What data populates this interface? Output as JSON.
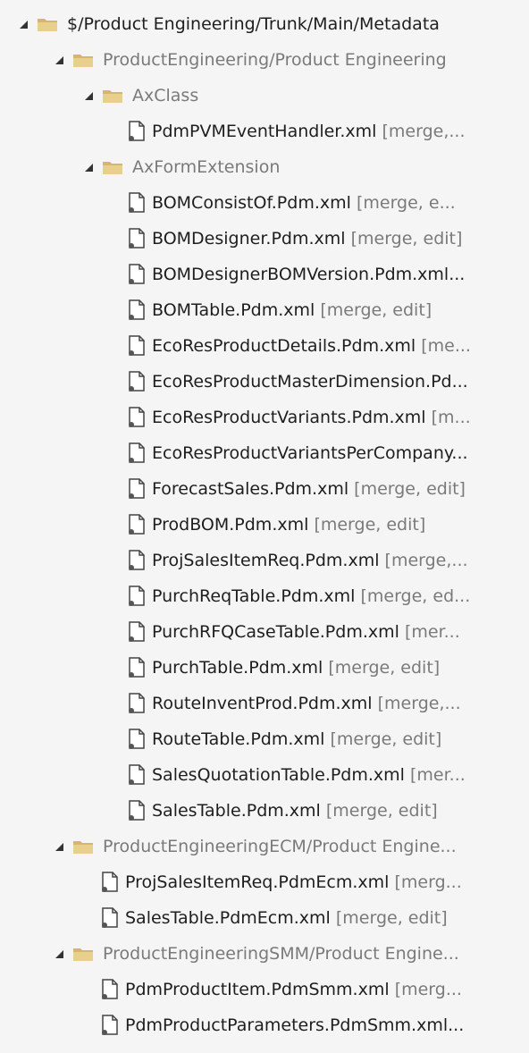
{
  "tree": {
    "root": "$/Product Engineering/Trunk/Main/Metadata",
    "groups": [
      {
        "label": "ProductEngineering/Product Engineering",
        "subfolders": [
          {
            "label": "AxClass",
            "files": [
              {
                "name": "PdmPVMEventHandler.xml",
                "status": "[merge,..."
              }
            ]
          },
          {
            "label": "AxFormExtension",
            "files": [
              {
                "name": "BOMConsistOf.Pdm.xml",
                "status": "[merge, e..."
              },
              {
                "name": "BOMDesigner.Pdm.xml",
                "status": "[merge, edit]"
              },
              {
                "name": "BOMDesignerBOMVersion.Pdm.xml...",
                "status": ""
              },
              {
                "name": "BOMTable.Pdm.xml",
                "status": "[merge, edit]"
              },
              {
                "name": "EcoResProductDetails.Pdm.xml",
                "status": "[me..."
              },
              {
                "name": "EcoResProductMasterDimension.Pd...",
                "status": ""
              },
              {
                "name": "EcoResProductVariants.Pdm.xml",
                "status": "[m..."
              },
              {
                "name": "EcoResProductVariantsPerCompany...",
                "status": ""
              },
              {
                "name": "ForecastSales.Pdm.xml",
                "status": "[merge, edit]"
              },
              {
                "name": "ProdBOM.Pdm.xml",
                "status": "[merge, edit]"
              },
              {
                "name": "ProjSalesItemReq.Pdm.xml",
                "status": "[merge,..."
              },
              {
                "name": "PurchReqTable.Pdm.xml",
                "status": "[merge, ed..."
              },
              {
                "name": "PurchRFQCaseTable.Pdm.xml",
                "status": "[mer..."
              },
              {
                "name": "PurchTable.Pdm.xml",
                "status": "[merge, edit]"
              },
              {
                "name": "RouteInventProd.Pdm.xml",
                "status": "[merge,..."
              },
              {
                "name": "RouteTable.Pdm.xml",
                "status": "[merge, edit]"
              },
              {
                "name": "SalesQuotationTable.Pdm.xml",
                "status": "[mer..."
              },
              {
                "name": "SalesTable.Pdm.xml",
                "status": "[merge, edit]"
              }
            ]
          }
        ]
      },
      {
        "label": "ProductEngineeringECM/Product Engine...",
        "files": [
          {
            "name": "ProjSalesItemReq.PdmEcm.xml",
            "status": "[merg..."
          },
          {
            "name": "SalesTable.PdmEcm.xml",
            "status": "[merge, edit]"
          }
        ]
      },
      {
        "label": "ProductEngineeringSMM/Product Engine...",
        "files": [
          {
            "name": "PdmProductItem.PdmSmm.xml",
            "status": "[merg..."
          },
          {
            "name": "PdmProductParameters.PdmSmm.xml...",
            "status": ""
          }
        ]
      }
    ]
  }
}
